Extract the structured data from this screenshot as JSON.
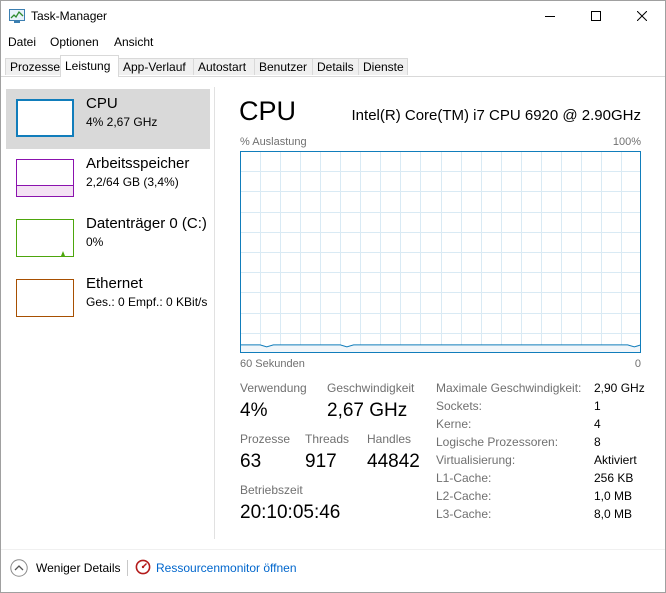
{
  "window": {
    "title": "Task-Manager"
  },
  "menu": {
    "items": [
      "Datei",
      "Optionen",
      "Ansicht"
    ]
  },
  "tabs": [
    "Prozesse",
    "Leistung",
    "App-Verlauf",
    "Autostart",
    "Benutzer",
    "Details",
    "Dienste"
  ],
  "active_tab": "Leistung",
  "sidebar": {
    "items": [
      {
        "name": "CPU",
        "sub": "4%  2,67 GHz",
        "color": "#117dbb",
        "selected": true
      },
      {
        "name": "Arbeitsspeicher",
        "sub": "2,2/64  GB (3,4%)",
        "color": "#8b12ae",
        "fill_fraction": 0.034
      },
      {
        "name": "Datenträger 0 (C:)",
        "sub": "0%",
        "color": "#4da60c"
      },
      {
        "name": "Ethernet",
        "sub": "Ges.: 0  Empf.: 0 KBit/s",
        "color": "#a74f01"
      }
    ]
  },
  "cpu": {
    "title": "CPU",
    "model": "Intel(R) Core(TM) i7 CPU 6920 @ 2.90GHz",
    "graph": {
      "y_label": "% Auslastung",
      "y_max_label": "100%",
      "x_left_label": "60 Sekunden",
      "x_right_label": "0",
      "line_color": "#117dbb",
      "grid_color": "#d9eaf4",
      "usage_history": [
        4,
        4,
        4,
        4,
        3,
        4,
        4,
        4,
        4,
        4,
        4,
        4,
        4,
        4,
        4,
        4,
        3,
        4,
        4,
        4,
        4,
        4,
        4,
        4,
        4,
        4,
        4,
        4,
        4,
        4,
        4,
        4,
        4,
        4,
        4,
        4,
        4,
        4,
        4,
        4,
        4,
        4,
        4,
        4,
        4,
        4,
        4,
        4,
        4,
        4,
        4,
        4,
        4,
        4,
        4,
        4,
        4,
        4,
        4,
        3,
        4
      ]
    },
    "stats": {
      "verwendung_label": "Verwendung",
      "verwendung_value": "4%",
      "geschwindigkeit_label": "Geschwindigkeit",
      "geschwindigkeit_value": "2,67 GHz",
      "prozesse_label": "Prozesse",
      "prozesse_value": "63",
      "threads_label": "Threads",
      "threads_value": "917",
      "handles_label": "Handles",
      "handles_value": "44842",
      "betriebszeit_label": "Betriebszeit",
      "betriebszeit_value": "20:10:05:46"
    },
    "info": [
      {
        "label": "Maximale Geschwindigkeit:",
        "value": "2,90 GHz"
      },
      {
        "label": "Sockets:",
        "value": "1"
      },
      {
        "label": "Kerne:",
        "value": "4"
      },
      {
        "label": "Logische Prozessoren:",
        "value": "8"
      },
      {
        "label": "Virtualisierung:",
        "value": "Aktiviert"
      },
      {
        "label": "L1-Cache:",
        "value": "256 KB"
      },
      {
        "label": "L2-Cache:",
        "value": "1,0 MB"
      },
      {
        "label": "L3-Cache:",
        "value": "8,0 MB"
      }
    ]
  },
  "footer": {
    "fewer_details": "Weniger Details",
    "resource_monitor": "Ressourcenmonitor öffnen"
  }
}
